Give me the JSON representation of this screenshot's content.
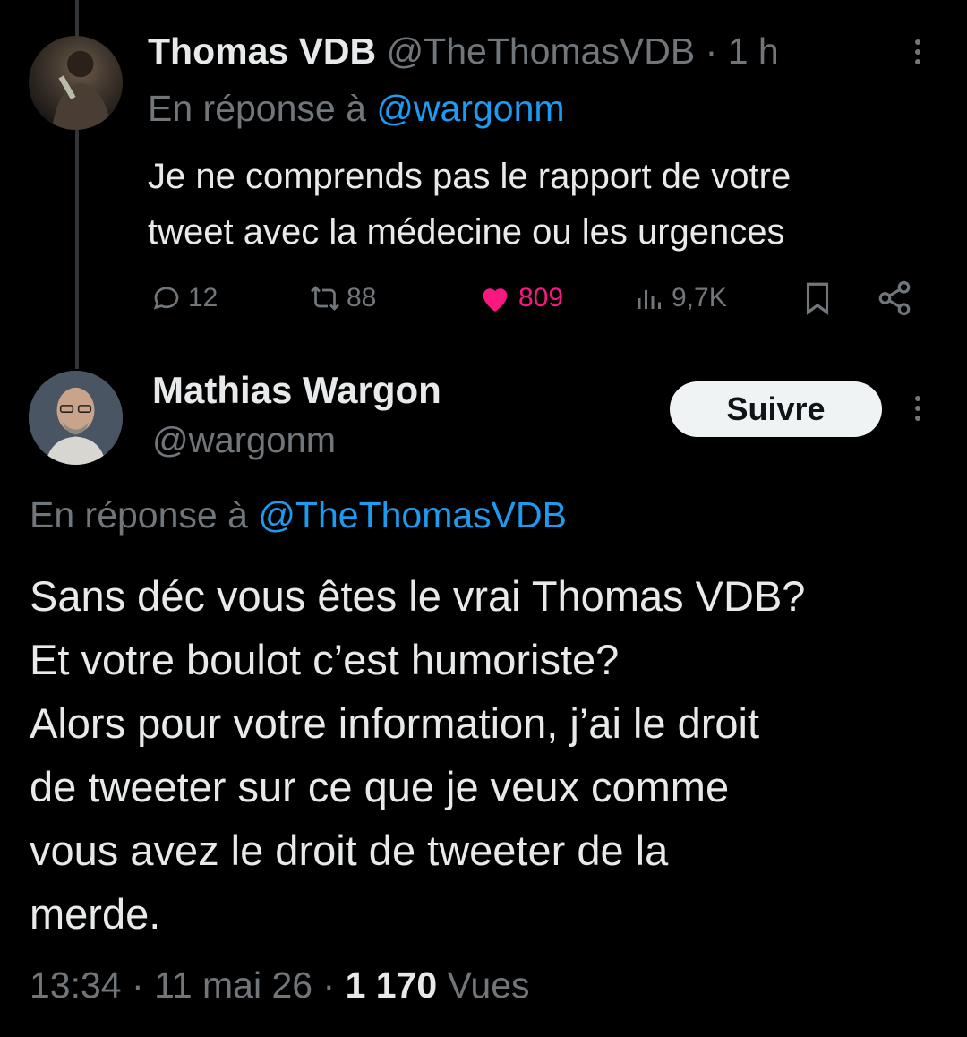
{
  "parent_tweet": {
    "author_name": "Thomas VDB",
    "handle": "@TheThomasVDB",
    "separator": "·",
    "time": "1 h",
    "reply_prefix": "En réponse à",
    "reply_to": "@wargonm",
    "body_lines": [
      "Je ne comprends pas le rapport de votre",
      "tweet avec la médecine ou les urgences"
    ],
    "actions": {
      "replies": "12",
      "retweets": "88",
      "likes": "809",
      "views": "9,7K"
    },
    "like_color": "#f91880",
    "icons": [
      "reply-icon",
      "retweet-icon",
      "heart-icon",
      "views-icon",
      "bookmark-icon",
      "share-icon",
      "more-icon"
    ]
  },
  "main_tweet": {
    "author_name": "Mathias Wargon",
    "handle": "@wargonm",
    "follow_label": "Suivre",
    "reply_prefix": "En réponse à",
    "reply_to": "@TheThomasVDB",
    "body_lines": [
      "Sans déc vous êtes le vrai Thomas VDB?",
      "Et votre boulot c’est humoriste?",
      "Alors pour votre information, j’ai le droit",
      "de tweeter sur ce que je veux comme",
      "vous avez le droit de tweeter de la",
      "merde."
    ],
    "time": "13:34",
    "separator": "·",
    "date": "11 mai 26",
    "views_count": "1 170",
    "views_label": "Vues"
  },
  "colors": {
    "background": "#000000",
    "text": "#e7e9ea",
    "muted": "#71767b",
    "link": "#1d9bf0"
  }
}
